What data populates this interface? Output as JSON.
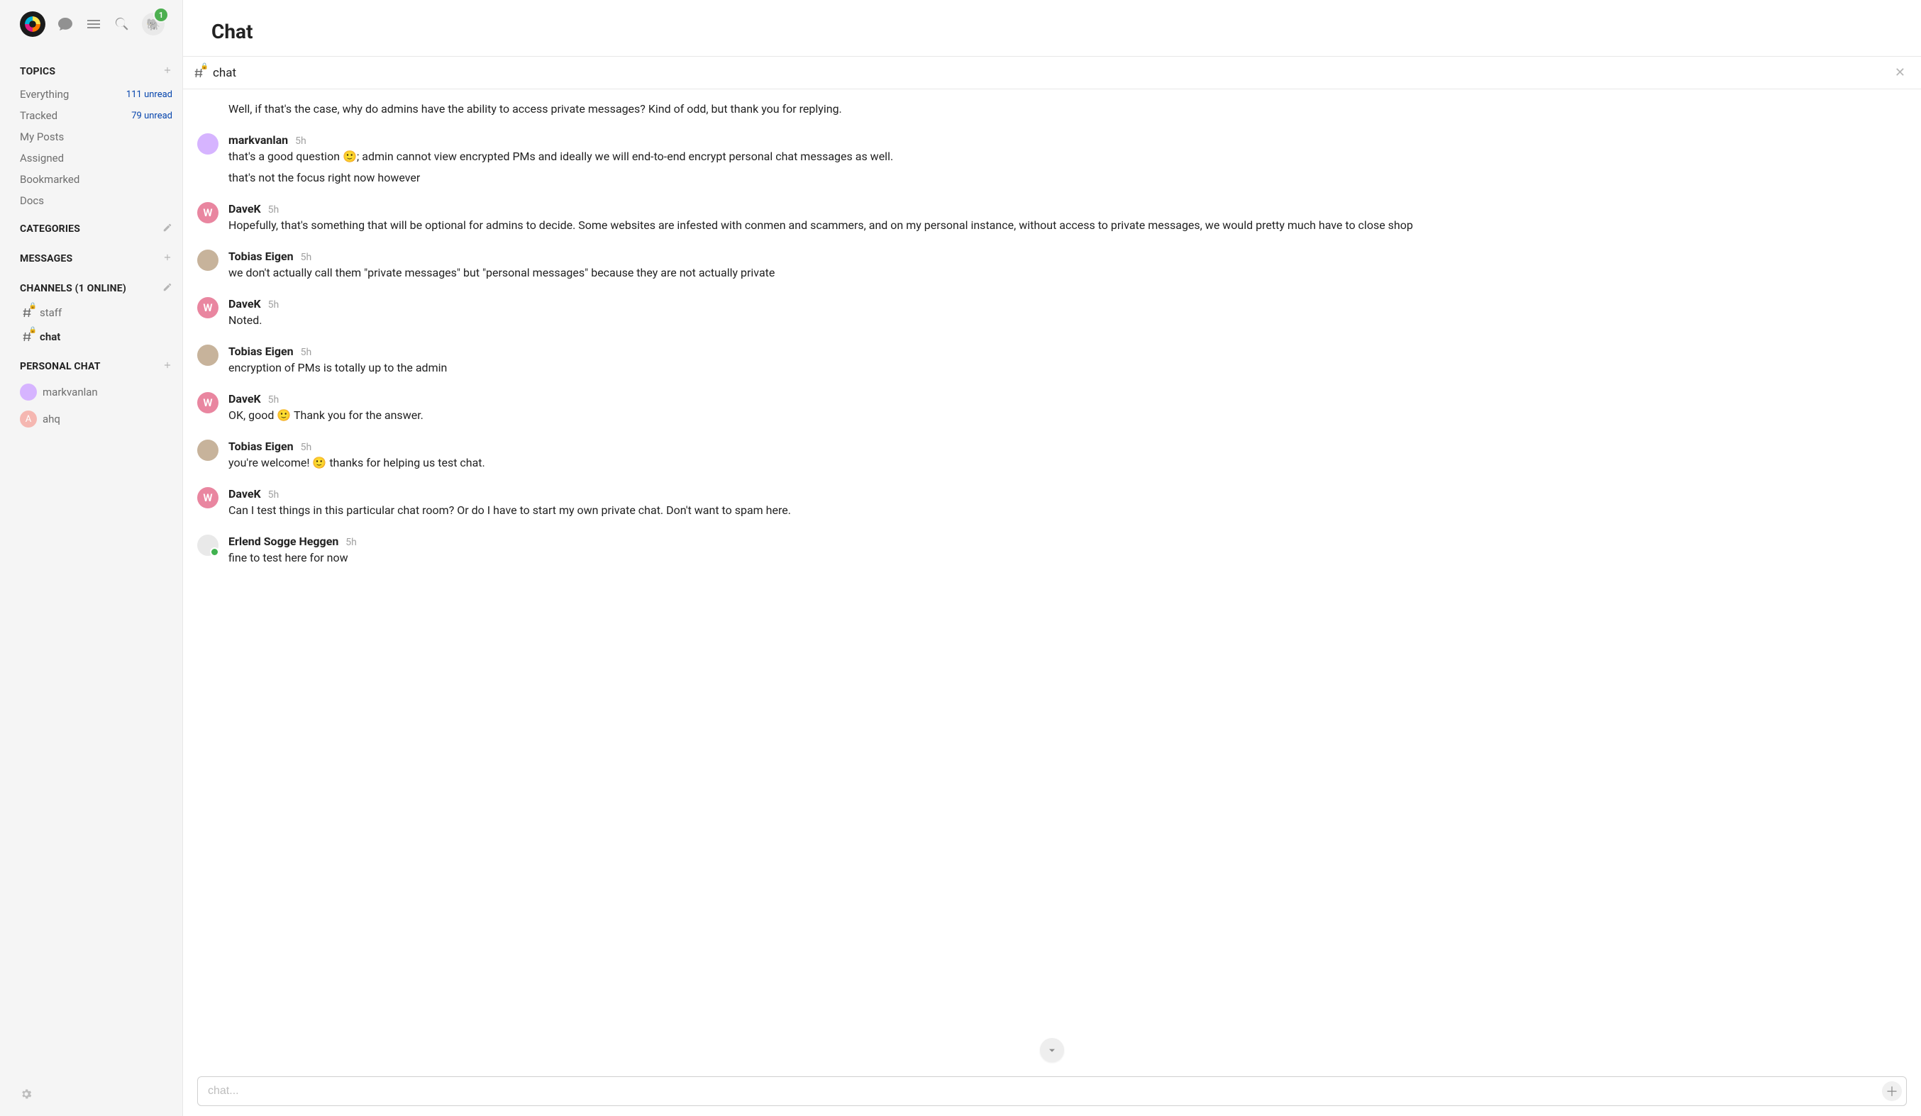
{
  "header": {
    "notification_badge": "1"
  },
  "page": {
    "title": "Chat"
  },
  "sidebar": {
    "topics": {
      "heading": "TOPICS",
      "items": [
        {
          "label": "Everything",
          "count": "111 unread"
        },
        {
          "label": "Tracked",
          "count": "79 unread"
        },
        {
          "label": "My Posts",
          "count": ""
        },
        {
          "label": "Assigned",
          "count": ""
        },
        {
          "label": "Bookmarked",
          "count": ""
        },
        {
          "label": "Docs",
          "count": ""
        }
      ]
    },
    "categories": {
      "heading": "CATEGORIES"
    },
    "messages": {
      "heading": "MESSAGES"
    },
    "channels": {
      "heading": "CHANNELS (1 ONLINE)",
      "items": [
        {
          "label": "staff",
          "locked": true,
          "active": false
        },
        {
          "label": "chat",
          "locked": true,
          "active": true
        }
      ]
    },
    "personal_chat": {
      "heading": "PERSONAL CHAT",
      "items": [
        {
          "label": "markvanlan",
          "avatar_bg": "#d6b4ff",
          "avatar_text": ""
        },
        {
          "label": "ahq",
          "avatar_bg": "#f5b7b1",
          "avatar_text": "A"
        }
      ]
    }
  },
  "channel_bar": {
    "name": "chat",
    "locked": true
  },
  "messages": [
    {
      "user": "DaveK",
      "initial": "W",
      "avatar_bg": "#e986a0",
      "time": "",
      "lines": [
        "Well, if that's the case, why do admins have the ability to access private messages? Kind of odd, but thank you for replying."
      ],
      "hide_meta": true
    },
    {
      "user": "markvanlan",
      "initial": "",
      "avatar_bg": "#d6b4ff",
      "time": "5h",
      "lines": [
        "that's a good question 🙂; admin cannot view encrypted PMs and ideally we will end-to-end encrypt personal chat messages as well.",
        "that's not the focus right now however"
      ]
    },
    {
      "user": "DaveK",
      "initial": "W",
      "avatar_bg": "#e986a0",
      "time": "5h",
      "lines": [
        "Hopefully, that's something that will be optional for admins to decide. Some websites are infested with conmen and scammers, and on my personal instance, without access to private messages, we would pretty much have to close shop"
      ]
    },
    {
      "user": "Tobias Eigen",
      "initial": "",
      "avatar_bg": "#c7b39b",
      "time": "5h",
      "lines": [
        "we don't actually call them \"private messages\" but \"personal messages\" because they are not actually private"
      ]
    },
    {
      "user": "DaveK",
      "initial": "W",
      "avatar_bg": "#e986a0",
      "time": "5h",
      "lines": [
        "Noted."
      ]
    },
    {
      "user": "Tobias Eigen",
      "initial": "",
      "avatar_bg": "#c7b39b",
      "time": "5h",
      "lines": [
        "encryption of PMs is totally up to the admin"
      ]
    },
    {
      "user": "DaveK",
      "initial": "W",
      "avatar_bg": "#e986a0",
      "time": "5h",
      "lines": [
        "OK, good 🙂 Thank you for the answer."
      ]
    },
    {
      "user": "Tobias Eigen",
      "initial": "",
      "avatar_bg": "#c7b39b",
      "time": "5h",
      "lines": [
        "you're welcome! 🙂 thanks for helping us test chat."
      ]
    },
    {
      "user": "DaveK",
      "initial": "W",
      "avatar_bg": "#e986a0",
      "time": "5h",
      "lines": [
        "Can I test things in this particular chat room? Or do I have to start my own private chat. Don't want to spam here."
      ]
    },
    {
      "user": "Erlend Sogge Heggen",
      "initial": "",
      "avatar_bg": "#e9e9e9",
      "time": "5h",
      "online": true,
      "lines": [
        "fine to test here for now"
      ]
    }
  ],
  "composer": {
    "placeholder": "chat..."
  }
}
